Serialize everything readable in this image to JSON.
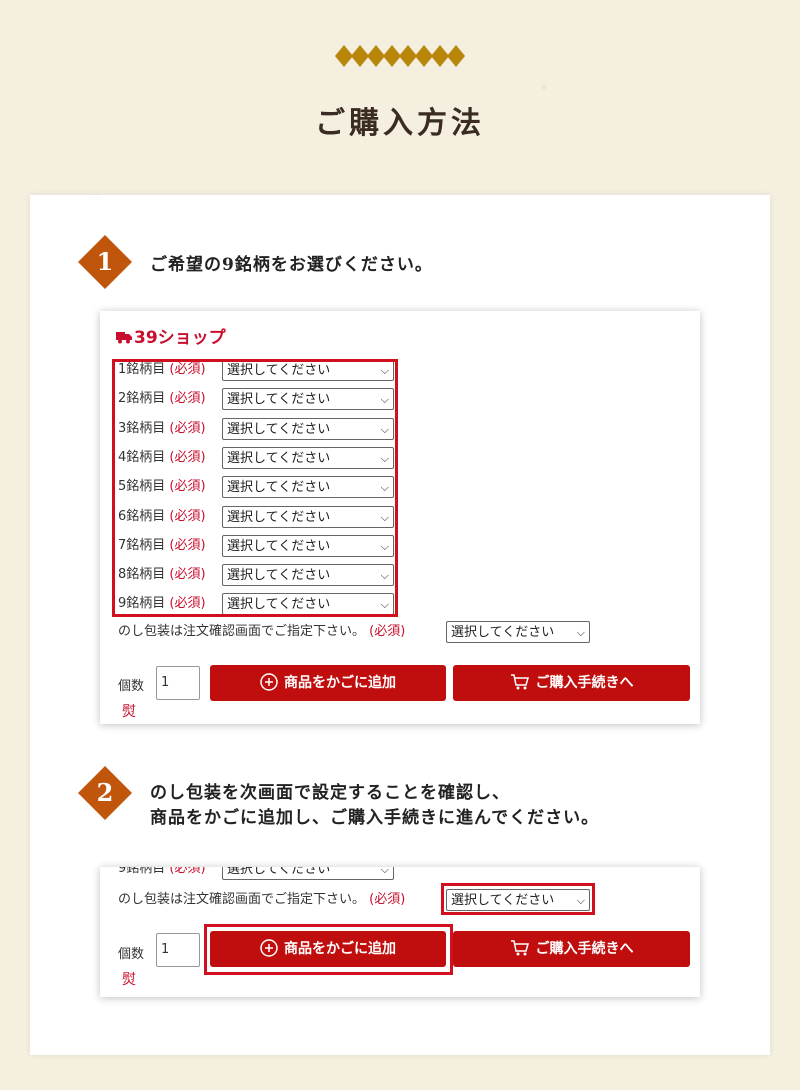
{
  "page": {
    "title": "ご購入方法",
    "accent_color": "#c0560b",
    "brand_red": "#c00d0d"
  },
  "step1": {
    "number": "1",
    "text": "ご希望の9銘柄をお選びください。"
  },
  "step2": {
    "number": "2",
    "text_line1": "のし包装を次画面で設定することを確認し、",
    "text_line2": "商品をかごに追加し、ご購入手続きに進んでください。"
  },
  "shop": {
    "logo": "39ショップ",
    "required_label": "(必須)",
    "select_placeholder": "選択してください",
    "brand_rows": [
      {
        "label": "1銘柄目"
      },
      {
        "label": "2銘柄目"
      },
      {
        "label": "3銘柄目"
      },
      {
        "label": "4銘柄目"
      },
      {
        "label": "5銘柄目"
      },
      {
        "label": "6銘柄目"
      },
      {
        "label": "7銘柄目"
      },
      {
        "label": "8銘柄目"
      },
      {
        "label": "9銘柄目"
      }
    ],
    "noshi_label": "のし包装は注文確認画面でご指定下さい。",
    "quantity_label": "個数",
    "quantity_value": "1",
    "add_to_cart": "商品をかごに追加",
    "checkout": "ご購入手続きへ",
    "noshi_icon_glyph": "熨"
  }
}
